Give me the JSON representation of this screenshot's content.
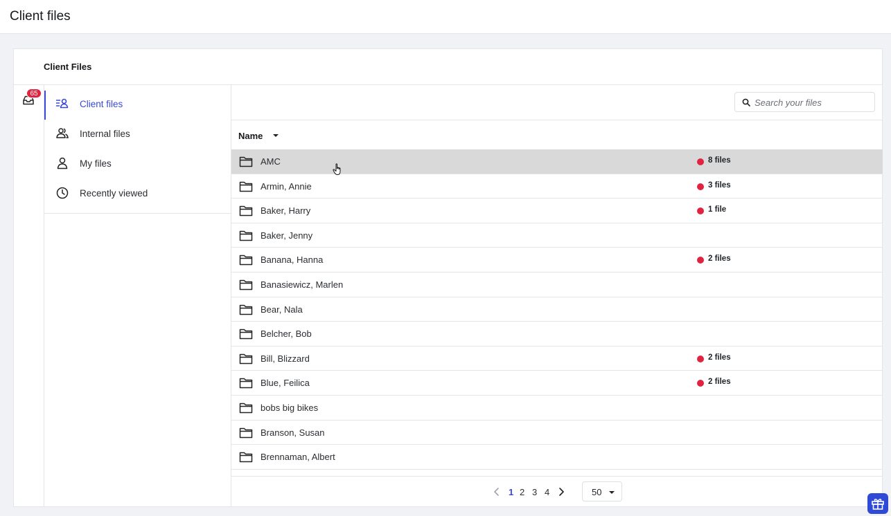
{
  "page": {
    "title": "Client files"
  },
  "card": {
    "title": "Client Files"
  },
  "rail": {
    "inbox_badge": "65",
    "inbox_icon": "inbox-icon"
  },
  "sidebar": {
    "items": [
      {
        "label": "Client files",
        "icon": "client-files-icon",
        "active": true
      },
      {
        "label": "Internal files",
        "icon": "users-icon",
        "active": false
      },
      {
        "label": "My files",
        "icon": "user-icon",
        "active": false
      },
      {
        "label": "Recently viewed",
        "icon": "clock-icon",
        "active": false
      }
    ]
  },
  "search": {
    "placeholder": "Search your files",
    "value": ""
  },
  "table": {
    "column_name": "Name",
    "rows": [
      {
        "name": "AMC",
        "count": "8 files",
        "hovered": true
      },
      {
        "name": "Armin, Annie",
        "count": "3 files"
      },
      {
        "name": "Baker, Harry",
        "count": "1 file"
      },
      {
        "name": "Baker, Jenny",
        "count": ""
      },
      {
        "name": "Banana, Hanna",
        "count": "2 files"
      },
      {
        "name": "Banasiewicz, Marlen",
        "count": ""
      },
      {
        "name": "Bear, Nala",
        "count": ""
      },
      {
        "name": "Belcher, Bob",
        "count": ""
      },
      {
        "name": "Bill, Blizzard",
        "count": "2 files"
      },
      {
        "name": "Blue, Feilica",
        "count": "2 files"
      },
      {
        "name": "bobs big bikes",
        "count": ""
      },
      {
        "name": "Branson, Susan",
        "count": ""
      },
      {
        "name": "Brennaman, Albert",
        "count": ""
      }
    ]
  },
  "pagination": {
    "pages": [
      "1",
      "2",
      "3",
      "4"
    ],
    "current": "1",
    "page_size": "50"
  },
  "colors": {
    "accent": "#3848d8",
    "badge": "#e0243f",
    "hover_row": "#d9d9d9"
  }
}
